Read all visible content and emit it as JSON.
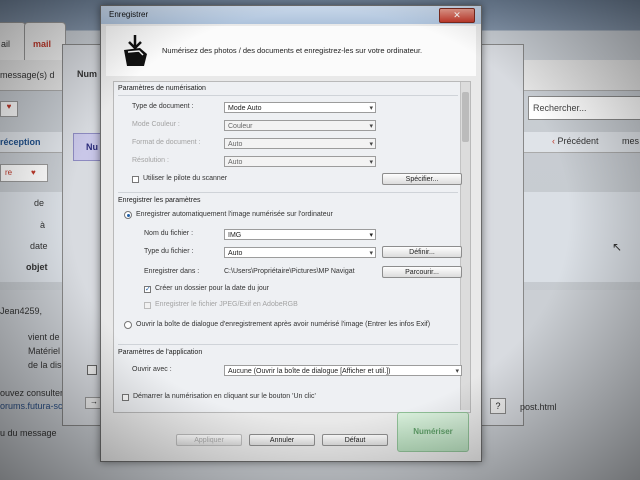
{
  "background": {
    "tab_mail": "mail",
    "tab_other": "ail",
    "msg_count": "message(s) d",
    "reception": "réception",
    "num_header": "Num",
    "num_box": "Nu",
    "search": "Rechercher...",
    "prev": "Précédent",
    "next": "mes",
    "fields": [
      "de",
      "à",
      "date",
      "objet"
    ],
    "greeting": "Jean4259,",
    "body_lines": [
      "vient de répon",
      "Matériel - Hard",
      "de la discussion",
      "ouvez consulter",
      "orums.futura-sci",
      "u du message"
    ],
    "link": "post.html",
    "question": "?"
  },
  "dialog": {
    "title": "Enregistrer",
    "close": "✕",
    "header_text": "Numérisez des photos / des documents et enregistrez-les sur votre ordinateur.",
    "scan_section": "Paramètres de numérisation",
    "doc_type_label": "Type de document :",
    "doc_type_value": "Mode Auto",
    "color_mode_label": "Mode Couleur :",
    "color_mode_value": "Couleur",
    "doc_format_label": "Format de document :",
    "doc_format_value": "Auto",
    "resolution_label": "Résolution :",
    "resolution_value": "Auto",
    "use_driver_label": "Utiliser le pilote du scanner",
    "specify_btn": "Spécifier...",
    "save_section": "Enregistrer les paramètres",
    "auto_save_label": "Enregistrer automatiquement l'image numérisée sur l'ordinateur",
    "file_name_label": "Nom du fichier :",
    "file_name_value": "IMG",
    "file_type_label": "Type du fichier :",
    "file_type_value": "Auto",
    "define_btn": "Définir...",
    "save_in_label": "Enregistrer dans :",
    "save_in_value": "C:\\Users\\Propriétaire\\Pictures\\MP Navigat",
    "browse_btn": "Parcourir...",
    "date_folder_label": "Créer un dossier pour la date du jour",
    "adobe_label": "Enregistrer le fichier JPEG/Exif en AdobeRGB",
    "open_dialog_label": "Ouvrir la boîte de dialogue d'enregistrement après avoir numérisé l'image (Entrer les infos Exif)",
    "app_section": "Paramètres de l'application",
    "open_with_label": "Ouvrir avec :",
    "open_with_value": "Aucune (Ouvrir la boîte de dialogue [Afficher et util.])",
    "one_click_label": "Démarrer la numérisation en cliquant sur le bouton 'Un clic'",
    "apply_btn": "Appliquer",
    "cancel_btn": "Annuler",
    "default_btn": "Défaut",
    "scan_btn": "Numériser",
    "arrow": "▾"
  }
}
